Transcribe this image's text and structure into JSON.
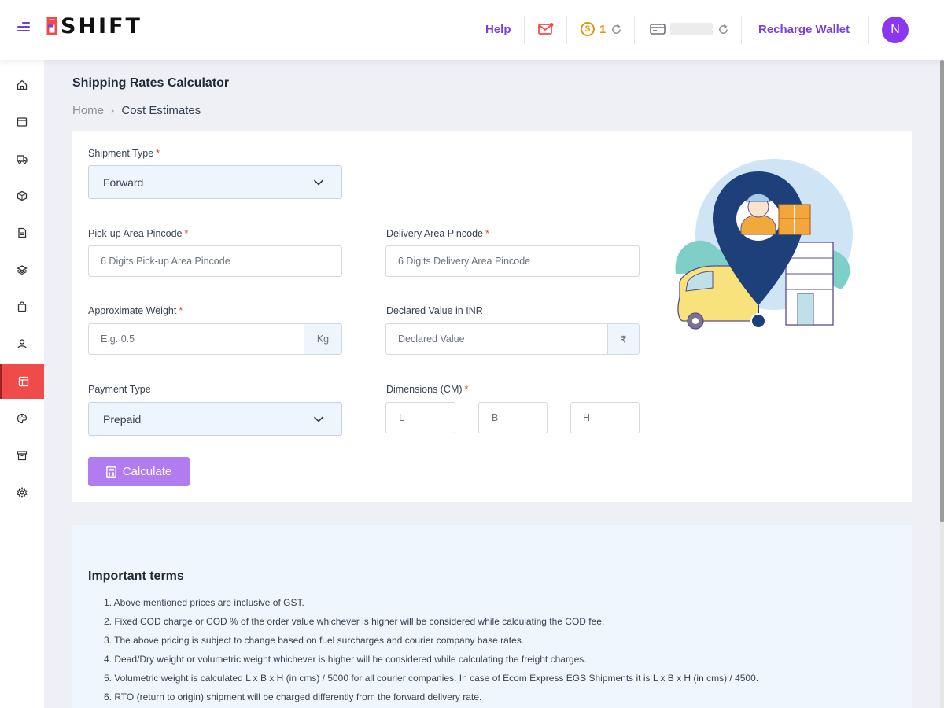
{
  "header": {
    "brand": "SHIFT",
    "help": "Help",
    "coin_count": "1",
    "coin_symbol": "$",
    "recharge": "Recharge Wallet",
    "avatar_initial": "N"
  },
  "sidebar": {
    "items": [
      {
        "icon": "home-icon"
      },
      {
        "icon": "orders-icon"
      },
      {
        "icon": "truck-icon"
      },
      {
        "icon": "box-icon"
      },
      {
        "icon": "document-icon"
      },
      {
        "icon": "layers-icon"
      },
      {
        "icon": "bag-icon"
      },
      {
        "icon": "user-icon"
      },
      {
        "icon": "calculator-layout-icon",
        "active": true
      },
      {
        "icon": "palette-icon"
      },
      {
        "icon": "archive-icon"
      },
      {
        "icon": "settings-icon"
      }
    ]
  },
  "page": {
    "title": "Shipping Rates Calculator",
    "breadcrumb": [
      "Home",
      "Cost Estimates"
    ]
  },
  "form": {
    "shipment_type_label": "Shipment Type",
    "shipment_type_value": "Forward",
    "pickup_label": "Pick-up Area Pincode",
    "pickup_placeholder": "6 Digits Pick-up Area Pincode",
    "delivery_label": "Delivery Area Pincode",
    "delivery_placeholder": "6 Digits Delivery Area Pincode",
    "weight_label": "Approximate Weight",
    "weight_placeholder": "E.g. 0.5",
    "weight_unit": "Kg",
    "declared_label": "Declared Value in INR",
    "declared_placeholder": "Declared Value",
    "currency": "₹",
    "payment_label": "Payment Type",
    "payment_value": "Prepaid",
    "dimensions_label": "Dimensions (CM)",
    "dim_l": "L",
    "dim_b": "B",
    "dim_h": "H",
    "required_mark": "*",
    "calculate": "Calculate"
  },
  "terms": {
    "title": "Important terms",
    "items": [
      "1. Above mentioned prices are inclusive of GST.",
      "2. Fixed COD charge or COD % of the order value whichever is higher will be considered while calculating the COD fee.",
      "3. The above pricing is subject to change based on fuel surcharges and courier company base rates.",
      "4. Dead/Dry weight or volumetric weight whichever is higher will be considered while calculating the freight charges.",
      "5. Volumetric weight is calculated L x B x H (in cms) / 5000 for all courier companies. In case of Ecom Express EGS Shipments it is L x B x H (in cms) / 4500.",
      "6. RTO (return to origin) shipment will be charged differently from the forward delivery rate."
    ]
  },
  "colors": {
    "accent": "#7a3fe0",
    "active_sidebar": "#f04b4b",
    "button": "#b07cf0",
    "required": "#e53935"
  }
}
